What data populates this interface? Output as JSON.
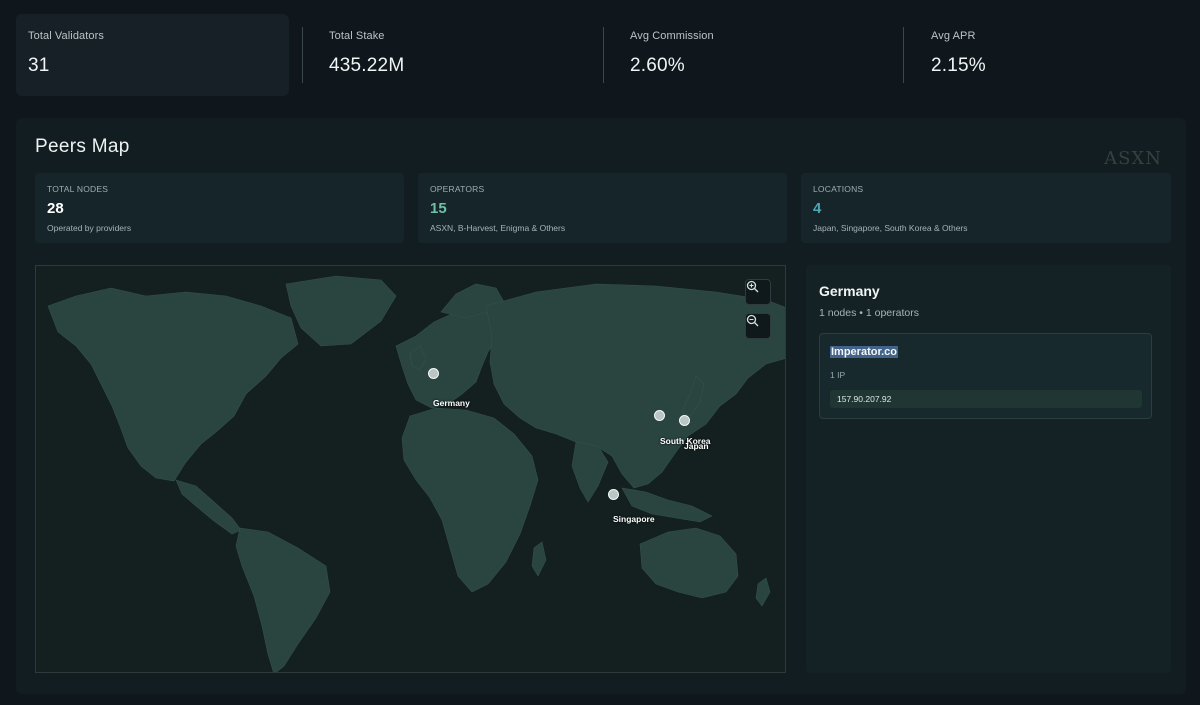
{
  "stats": [
    {
      "label": "Total Validators",
      "value": "31"
    },
    {
      "label": "Total Stake",
      "value": "435.22M"
    },
    {
      "label": "Avg Commission",
      "value": "2.60%"
    },
    {
      "label": "Avg APR",
      "value": "2.15%"
    }
  ],
  "peers_map": {
    "title": "Peers Map",
    "watermark": "ASXN",
    "summary": [
      {
        "label": "TOTAL NODES",
        "value": "28",
        "desc": "Operated by providers",
        "color": "#ffffff"
      },
      {
        "label": "OPERATORS",
        "value": "15",
        "desc": "ASXN, B-Harvest, Enigma & Others",
        "color": "#6fc0a4"
      },
      {
        "label": "LOCATIONS",
        "value": "4",
        "desc": "Japan, Singapore, South Korea & Others",
        "color": "#4fa7b4"
      }
    ],
    "map": {
      "zoom_in_icon": "zoom-in-icon",
      "zoom_out_icon": "zoom-out-icon",
      "locations": [
        {
          "name": "Germany"
        },
        {
          "name": "South Korea"
        },
        {
          "name": "Japan"
        },
        {
          "name": "Singapore"
        }
      ]
    },
    "detail": {
      "country": "Germany",
      "summary": "1 nodes • 1 operators",
      "operators": [
        {
          "name": "Imperator.co",
          "ip_count": "1 IP",
          "ips": [
            "157.90.207.92"
          ]
        }
      ]
    }
  },
  "colors": {
    "background": "#0f171c",
    "land": "#2a4440",
    "ocean": "#13201f",
    "operators_accent": "#6fc0a4",
    "locations_accent": "#4fa7b4"
  }
}
